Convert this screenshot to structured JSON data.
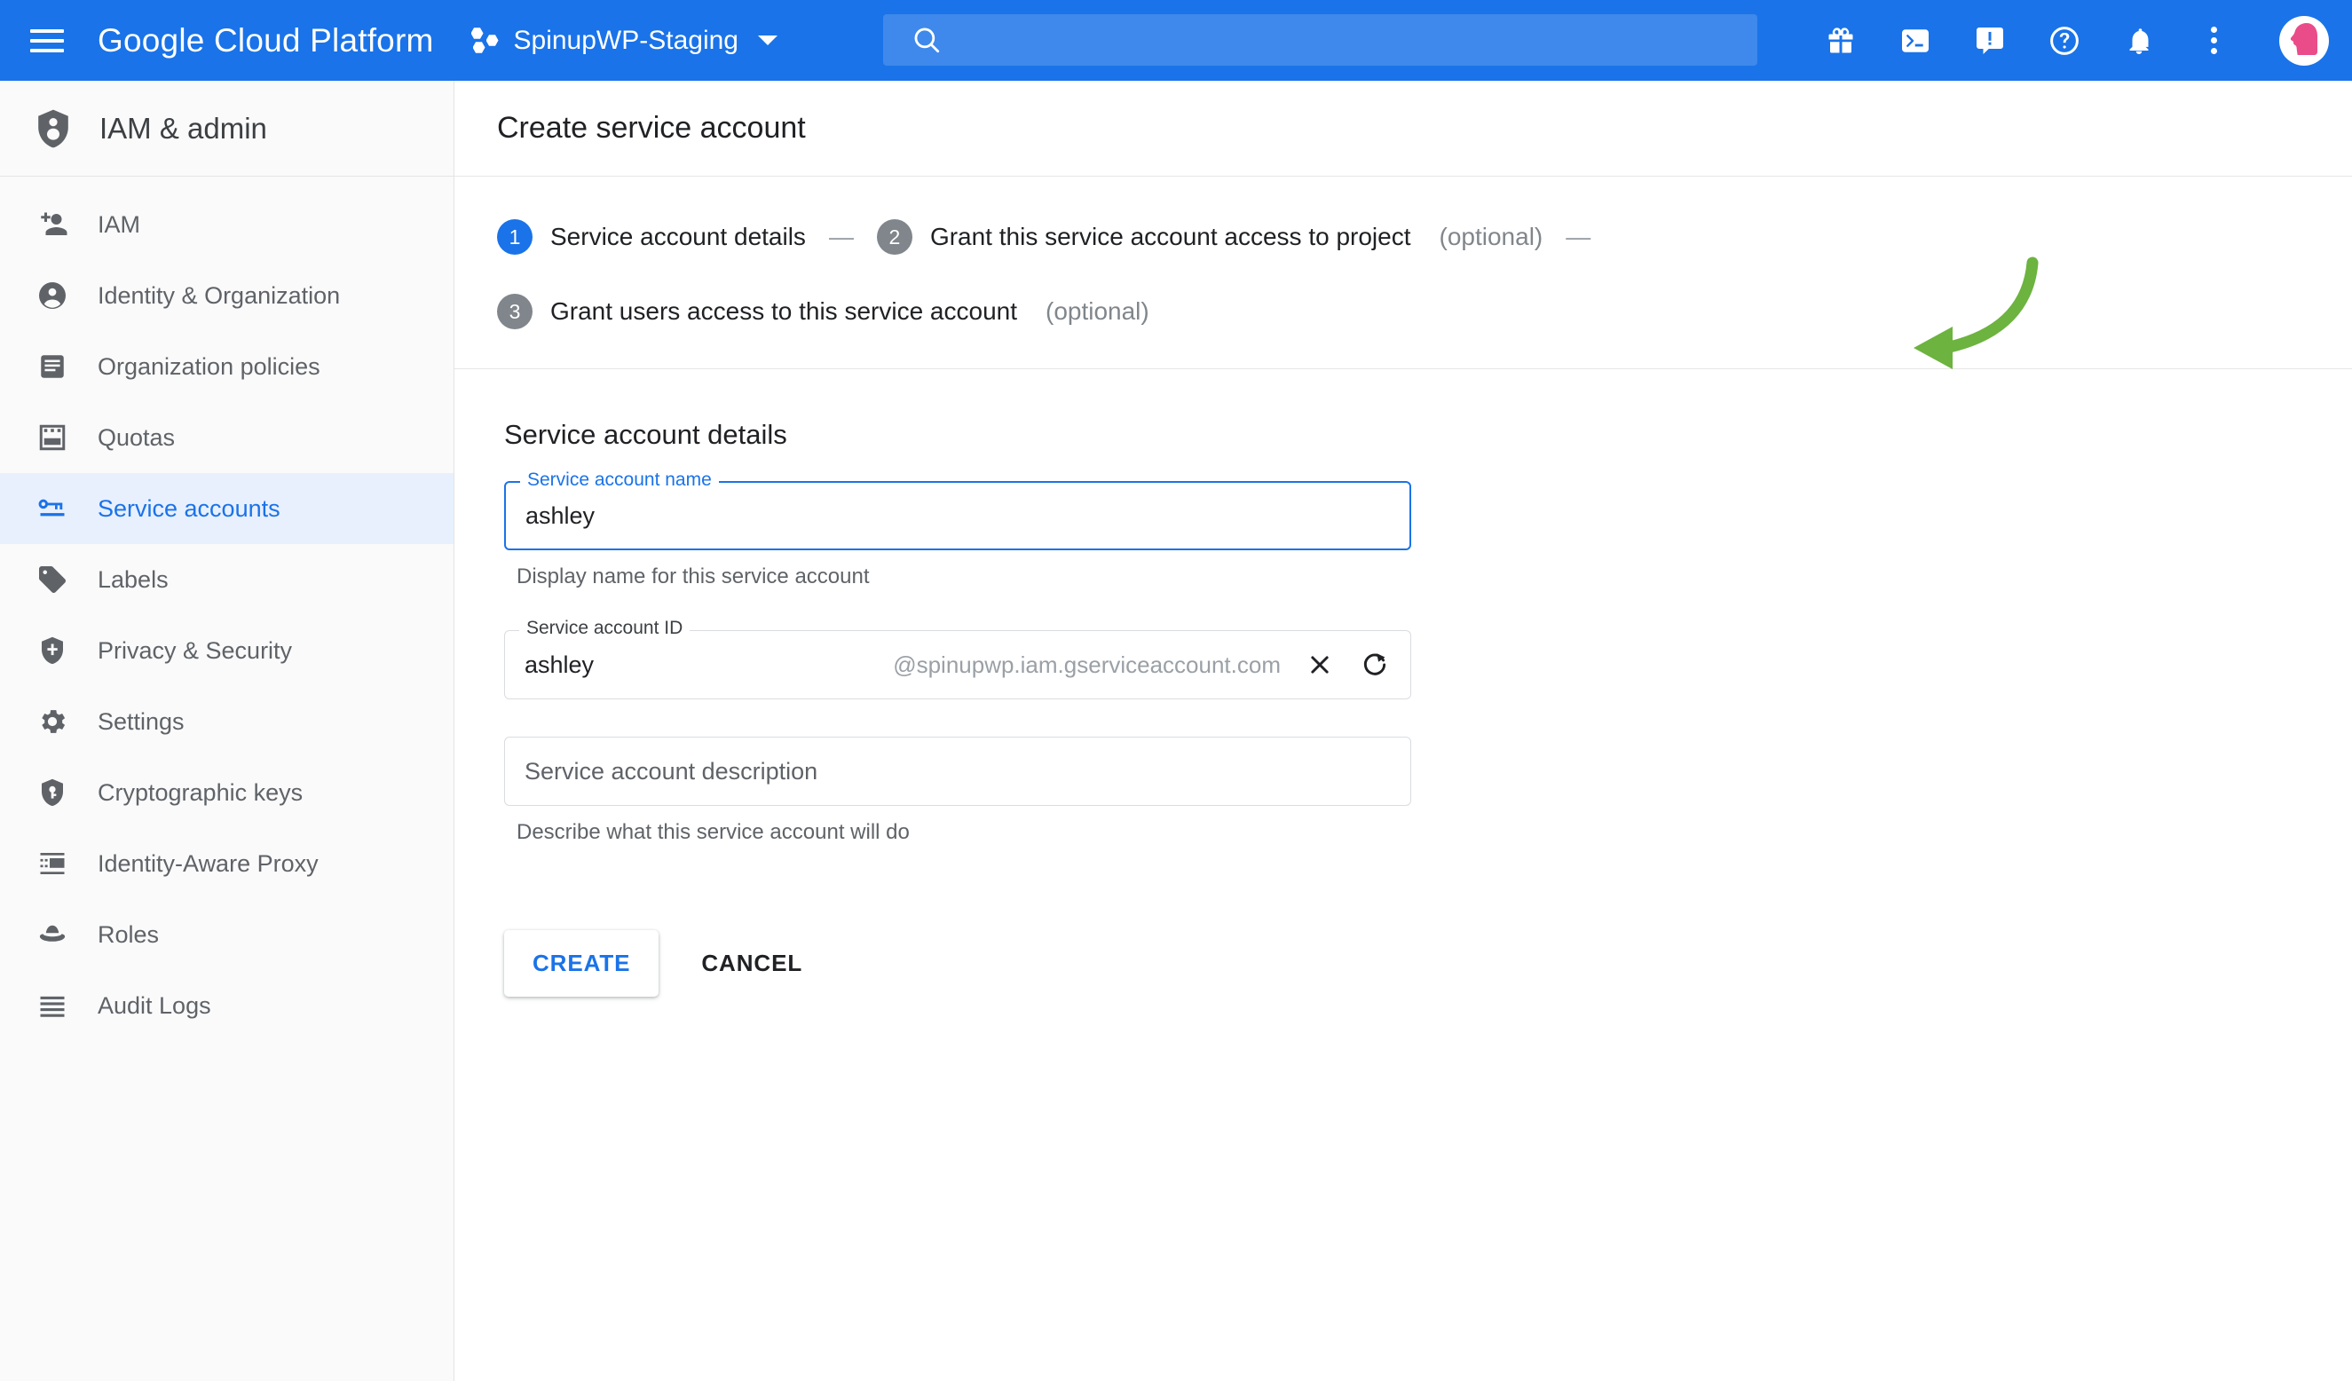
{
  "topbar": {
    "menu_icon": "hamburger-menu-icon",
    "brand": "Google Cloud Platform",
    "project_icon": "project-hexagons-icon",
    "project_name": "SpinupWP-Staging",
    "project_caret": "chevron-down-icon",
    "search": {
      "value": "",
      "placeholder": "",
      "icon": "search-icon"
    },
    "actions": [
      {
        "name": "gift-icon",
        "label": "Offers"
      },
      {
        "name": "cloud-shell-icon",
        "label": "Activate Cloud Shell"
      },
      {
        "name": "feedback-icon",
        "label": "Send feedback"
      },
      {
        "name": "help-icon",
        "label": "Help"
      },
      {
        "name": "notifications-bell-icon",
        "label": "Notifications"
      },
      {
        "name": "more-options-icon",
        "label": "More options"
      }
    ],
    "avatar": {
      "name": "user-avatar",
      "color": "#ea4c89"
    },
    "bg_color": "#1a73e8"
  },
  "sidebar": {
    "header": {
      "icon": "iam-shield-icon",
      "title": "IAM & admin"
    },
    "items": [
      {
        "label": "IAM",
        "icon": "person-add-icon",
        "active": false
      },
      {
        "label": "Identity & Organization",
        "icon": "account-circle-icon",
        "active": false
      },
      {
        "label": "Organization policies",
        "icon": "policy-document-icon",
        "active": false
      },
      {
        "label": "Quotas",
        "icon": "quotas-icon",
        "active": false
      },
      {
        "label": "Service accounts",
        "icon": "key-badge-icon",
        "active": true
      },
      {
        "label": "Labels",
        "icon": "label-tag-icon",
        "active": false
      },
      {
        "label": "Privacy & Security",
        "icon": "shield-security-icon",
        "active": false
      },
      {
        "label": "Settings",
        "icon": "gear-icon",
        "active": false
      },
      {
        "label": "Cryptographic keys",
        "icon": "shield-key-icon",
        "active": false
      },
      {
        "label": "Identity-Aware Proxy",
        "icon": "proxy-icon",
        "active": false
      },
      {
        "label": "Roles",
        "icon": "roles-hat-icon",
        "active": false
      },
      {
        "label": "Audit Logs",
        "icon": "audit-logs-icon",
        "active": false
      }
    ],
    "active_bg": "#e8f0fe",
    "active_fg": "#1a73e8"
  },
  "main": {
    "page_title": "Create service account",
    "steps": [
      {
        "number": "1",
        "text": "Service account details",
        "optional": "",
        "active": true
      },
      {
        "number": "2",
        "text": "Grant this service account access to project",
        "optional": "(optional)",
        "active": false
      },
      {
        "number": "3",
        "text": "Grant users access to this service account",
        "optional": "(optional)",
        "active": false
      }
    ],
    "step_dash": "—",
    "section_title": "Service account details",
    "fields": {
      "name": {
        "label": "Service account name",
        "value": "ashley",
        "placeholder": "",
        "helper": "Display name for this service account",
        "focused": true
      },
      "account_id": {
        "label": "Service account ID",
        "value": "ashley",
        "placeholder": "",
        "suffix": "@spinupwp.iam.gserviceaccount.com",
        "clear_icon": "clear-close-icon",
        "refresh_icon": "refresh-icon"
      },
      "description": {
        "label": "",
        "value": "",
        "placeholder": "Service account description",
        "helper": "Describe what this service account will do"
      }
    },
    "buttons": {
      "create": "CREATE",
      "cancel": "CANCEL"
    }
  },
  "annotation": {
    "arrow": {
      "name": "green-arrow-annotation",
      "color": "#6cb33f",
      "points_to": "service-account-name-input"
    }
  }
}
